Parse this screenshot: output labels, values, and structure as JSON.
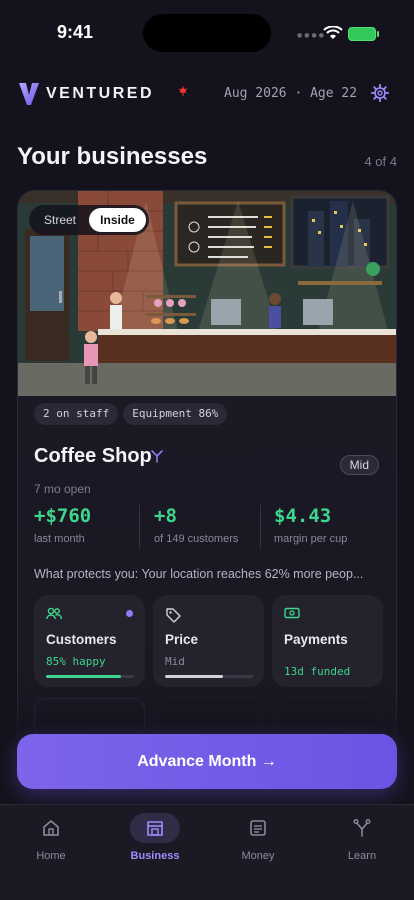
{
  "status": {
    "time": "9:41"
  },
  "header": {
    "brand": "VENTURED",
    "date_age": "Aug 2026 · Age 22"
  },
  "section": {
    "title": "Your businesses",
    "pager": "4 of 4"
  },
  "scene_toggle": {
    "options": [
      "Street",
      "Inside"
    ],
    "selected": "Inside"
  },
  "chips": [
    "2 on staff",
    "Equipment 86%"
  ],
  "business": {
    "name": "Coffee Shop",
    "tier": "Mid",
    "open_time": "7 mo open",
    "stats": [
      {
        "value": "+$760",
        "label": "last month"
      },
      {
        "value": "+8",
        "label": "of 149 customers"
      },
      {
        "value": "$4.43",
        "label": "margin per cup"
      }
    ],
    "protects": "What protects you: Your location reaches 62% more peop..."
  },
  "metrics": [
    {
      "title": "Customers",
      "sub": "85% happy",
      "progress": 0.85,
      "icon": "people-icon",
      "color": "#3dd68c",
      "alert": true
    },
    {
      "title": "Price",
      "sub": "Mid",
      "progress": 0.66,
      "icon": "tag-icon",
      "color": "#d2d0db",
      "alert": false
    },
    {
      "title": "Payments",
      "sub": "13d funded",
      "icon": "cash-icon",
      "color": "#3dd68c",
      "alert": false
    }
  ],
  "actions": {
    "advance": "Advance Month →"
  },
  "tabs": [
    {
      "label": "Home",
      "icon": "home-icon",
      "active": false
    },
    {
      "label": "Business",
      "icon": "store-icon",
      "active": true
    },
    {
      "label": "Money",
      "icon": "ledger-icon",
      "active": false
    },
    {
      "label": "Learn",
      "icon": "branch-icon",
      "active": false
    }
  ],
  "colors": {
    "accent": "#7d64ea",
    "positive": "#3dd68c",
    "background": "#14121c"
  }
}
